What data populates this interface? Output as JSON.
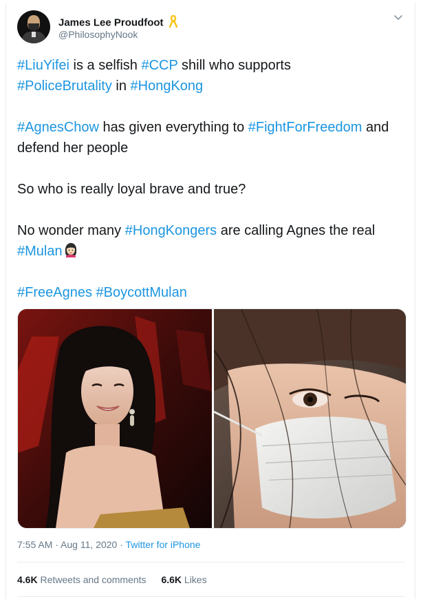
{
  "author": {
    "name": "James Lee Proudfoot",
    "handle": "@PhilosophyNook",
    "badge_icon": "yellow-ribbon-icon"
  },
  "tweet": {
    "p1": {
      "h1": "#LiuYifei",
      "t1": " is a selfish ",
      "h2": "#CCP",
      "t2": " shill who supports ",
      "h3": "#PoliceBrutality",
      "t3": " in ",
      "h4": "#HongKong"
    },
    "p2": {
      "h1": "#AgnesChow",
      "t1": " has given everything to ",
      "h2": "#FightForFreedom",
      "t2": " and defend her people"
    },
    "p3": {
      "t1": "So who is really loyal brave and true?"
    },
    "p4": {
      "t1": "No wonder many ",
      "h1": "#HongKongers",
      "t2": " are calling Agnes the real ",
      "h2": "#Mulan",
      "emoji": "woman-emoji"
    },
    "p5": {
      "h1": "#FreeAgnes",
      "t1": " ",
      "h2": "#BoycottMulan"
    }
  },
  "media": {
    "left_photo": "photo-woman-smiling-red-backdrop",
    "right_photo": "photo-woman-wearing-face-mask"
  },
  "meta": {
    "time": "7:55 AM",
    "sep1": " · ",
    "date": "Aug 11, 2020",
    "sep2": " · ",
    "source": "Twitter for iPhone"
  },
  "stats": {
    "retweets_count": "4.6K",
    "retweets_label": "Retweets and comments",
    "likes_count": "6.6K",
    "likes_label": "Likes"
  },
  "colors": {
    "link": "#1b95e0",
    "text": "#14171a",
    "secondary": "#657786",
    "border": "#e6ecf0"
  }
}
